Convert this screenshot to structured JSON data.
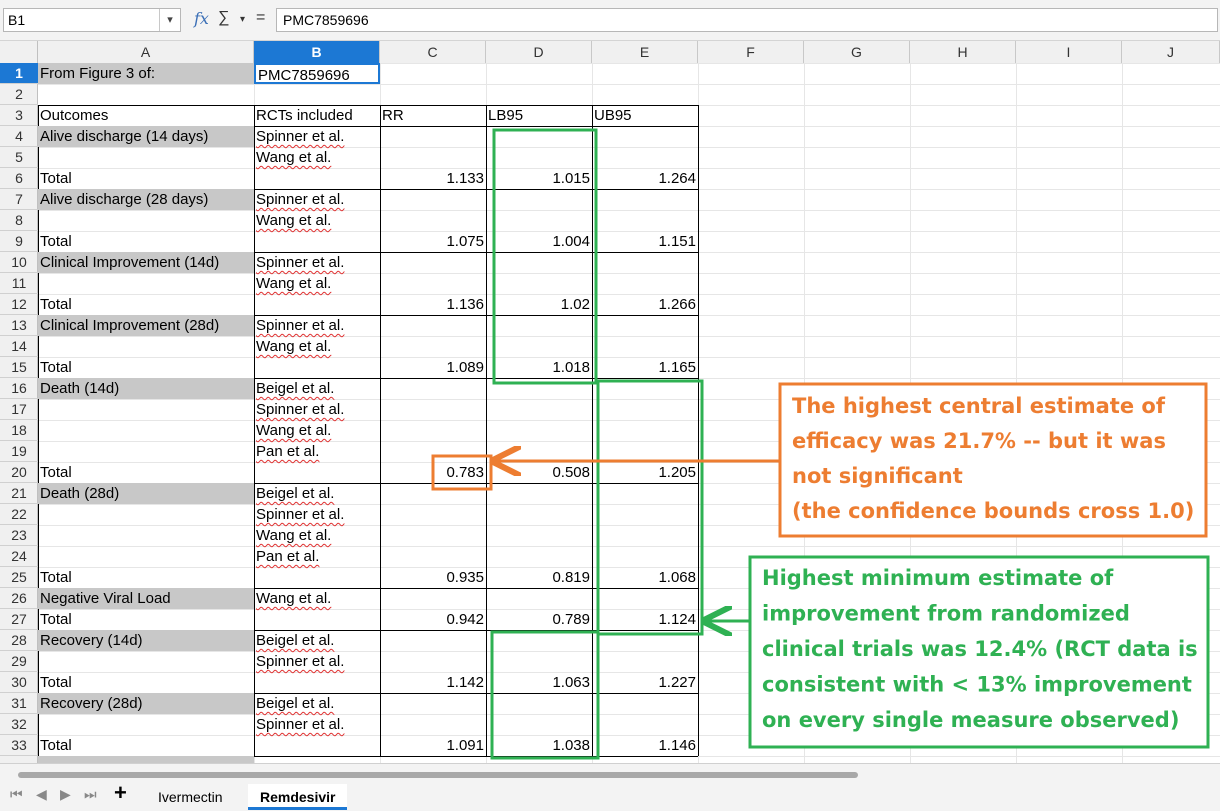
{
  "formula_bar": {
    "namebox": "B1",
    "formula": "PMC7859696",
    "fx_icon": "fx",
    "sum_icon": "∑",
    "sum_dropdown": "▾",
    "equals_icon": "="
  },
  "columns": [
    "A",
    "B",
    "C",
    "D",
    "E",
    "F",
    "G",
    "H",
    "I",
    "J"
  ],
  "selected_column": "B",
  "rows": [
    "1",
    "2",
    "3",
    "4",
    "5",
    "6",
    "7",
    "8",
    "9",
    "10",
    "11",
    "12",
    "13",
    "14",
    "15",
    "16",
    "17",
    "18",
    "19",
    "20",
    "21",
    "22",
    "23",
    "24",
    "25",
    "26",
    "27",
    "28",
    "29",
    "30",
    "31",
    "32",
    "33"
  ],
  "sheet": {
    "title_label": "From Figure 3 of:",
    "title_value": "PMC7859696",
    "headers": [
      "Outcomes",
      "RCTs included",
      "RR",
      "LB95",
      "UB95"
    ],
    "groups": [
      {
        "outcome": "Alive discharge (14 days)",
        "rcts": [
          "Spinner et al.",
          "Wang et al."
        ],
        "total_label": "Total",
        "rr": "1.133",
        "lb": "1.015",
        "ub": "1.264"
      },
      {
        "outcome": "Alive discharge (28 days)",
        "rcts": [
          "Spinner et al.",
          "Wang et al."
        ],
        "total_label": "Total",
        "rr": "1.075",
        "lb": "1.004",
        "ub": "1.151"
      },
      {
        "outcome": "Clinical Improvement (14d)",
        "rcts": [
          "Spinner et al.",
          "Wang et al."
        ],
        "total_label": "Total",
        "rr": "1.136",
        "lb": "1.02",
        "ub": "1.266"
      },
      {
        "outcome": "Clinical Improvement (28d)",
        "rcts": [
          "Spinner et al.",
          "Wang et al."
        ],
        "total_label": "Total",
        "rr": "1.089",
        "lb": "1.018",
        "ub": "1.165"
      },
      {
        "outcome": "Death (14d)",
        "rcts": [
          "Beigel et al.",
          "Spinner et al.",
          "Wang et al.",
          "Pan et al."
        ],
        "total_label": "Total",
        "rr": "0.783",
        "lb": "0.508",
        "ub": "1.205"
      },
      {
        "outcome": "Death (28d)",
        "rcts": [
          "Beigel et al.",
          "Spinner et al.",
          "Wang et al.",
          "Pan et al."
        ],
        "total_label": "Total",
        "rr": "0.935",
        "lb": "0.819",
        "ub": "1.068"
      },
      {
        "outcome": "Negative Viral Load",
        "rcts": [
          "Wang et al."
        ],
        "total_label": "Total",
        "rr": "0.942",
        "lb": "0.789",
        "ub": "1.124"
      },
      {
        "outcome": "Recovery (14d)",
        "rcts": [
          "Beigel et al.",
          "Spinner et al."
        ],
        "total_label": "Total",
        "rr": "1.142",
        "lb": "1.063",
        "ub": "1.227"
      },
      {
        "outcome": "Recovery (28d)",
        "rcts": [
          "Beigel et al.",
          "Spinner et al."
        ],
        "total_label": "Total",
        "rr": "1.091",
        "lb": "1.038",
        "ub": "1.146"
      }
    ]
  },
  "annotations": {
    "orange": {
      "lines": [
        "The highest central estimate of",
        "efficacy was 21.7% -- but it was",
        "not significant",
        "(the confidence bounds cross 1.0)"
      ],
      "color": "#ed7d31"
    },
    "green": {
      "lines": [
        "Highest minimum estimate of",
        "improvement from randomized",
        "clinical trials was 12.4% (RCT data is",
        "consistent with < 13% improvement",
        "on every single measure observed)"
      ],
      "color": "#2fb153"
    }
  },
  "tabs": {
    "nav_icons": [
      "⏮",
      "◀",
      "▶",
      "⏭"
    ],
    "add_icon": "+",
    "items": [
      "Ivermectin",
      "Remdesivir"
    ],
    "active": "Remdesivir"
  }
}
